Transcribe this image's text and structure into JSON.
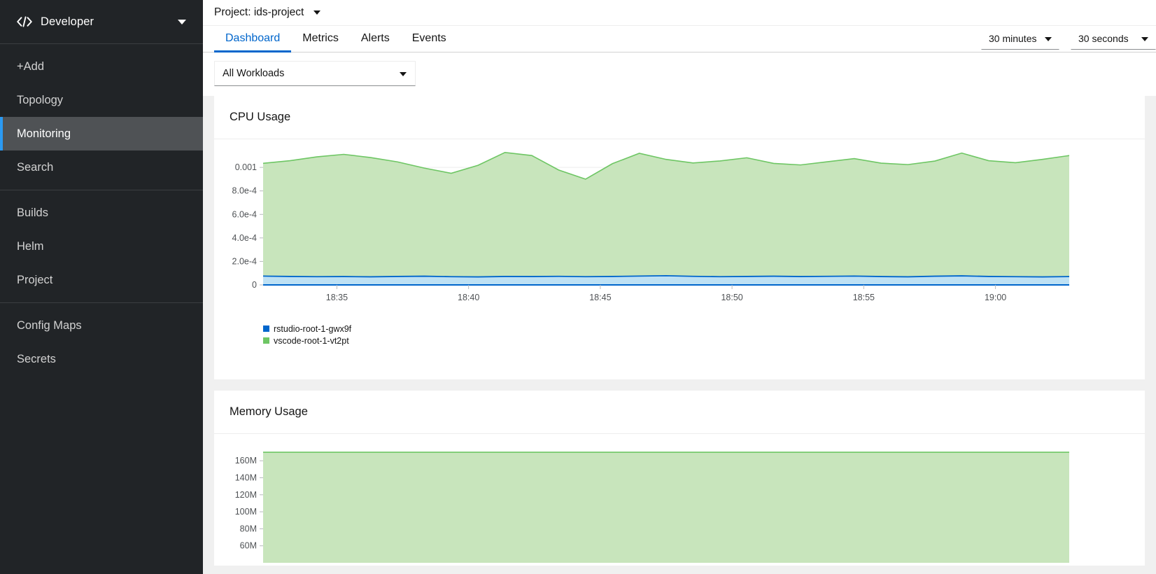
{
  "sidebar": {
    "perspective": {
      "label": "Developer",
      "icon": "code-icon",
      "caret": "chevron-down-icon"
    },
    "groups": [
      {
        "items": [
          {
            "label": "+Add",
            "active": false
          },
          {
            "label": "Topology",
            "active": false
          },
          {
            "label": "Monitoring",
            "active": true
          },
          {
            "label": "Search",
            "active": false
          }
        ]
      },
      {
        "items": [
          {
            "label": "Builds",
            "active": false
          },
          {
            "label": "Helm",
            "active": false
          },
          {
            "label": "Project",
            "active": false
          }
        ]
      },
      {
        "items": [
          {
            "label": "Config Maps",
            "active": false
          },
          {
            "label": "Secrets",
            "active": false
          }
        ]
      }
    ],
    "colors": {
      "bg": "#212427",
      "active_bg": "#4f5255",
      "active_bar": "#2b9af3"
    }
  },
  "header": {
    "project_label": "Project: ids-project",
    "project_caret": "chevron-down-icon"
  },
  "tabs": [
    {
      "label": "Dashboard",
      "active": true
    },
    {
      "label": "Metrics",
      "active": false
    },
    {
      "label": "Alerts",
      "active": false
    },
    {
      "label": "Events",
      "active": false
    }
  ],
  "toolbar": {
    "time_range": {
      "value": "30 minutes",
      "caret": "chevron-down-icon"
    },
    "refresh_interval": {
      "value": "30 seconds",
      "caret": "chevron-down-icon"
    }
  },
  "filters": {
    "workload": {
      "value": "All Workloads",
      "caret": "chevron-down-icon"
    }
  },
  "cards": [
    {
      "title": "CPU Usage"
    },
    {
      "title": "Memory Usage"
    }
  ],
  "colors": {
    "accent": "#0066cc",
    "series_blue_line": "#0066cc",
    "series_blue_fill": "#bee1f4",
    "series_green_line": "#6ec664",
    "series_green_fill": "#c8e5bc",
    "grid": "#ededed",
    "axis_text": "#4f5255",
    "page_bg": "#f0f0f0"
  },
  "chart_data": [
    {
      "type": "area",
      "title": "CPU Usage",
      "xlabel": "",
      "ylabel": "",
      "stacked": true,
      "grid": true,
      "legend_position": "bottom-left",
      "ytick_labels": [
        "0.001",
        "8.0e-4",
        "6.0e-4",
        "4.0e-4",
        "2.0e-4",
        "0"
      ],
      "ytick_values": [
        0.001,
        0.0008,
        0.0006,
        0.0004,
        0.0002,
        0
      ],
      "ylim": [
        0,
        0.00112
      ],
      "xtick_labels": [
        "18:35",
        "18:40",
        "18:45",
        "18:50",
        "18:55",
        "19:00"
      ],
      "x": [
        0,
        1,
        2,
        3,
        4,
        5,
        6,
        7,
        8,
        9,
        10,
        11,
        12,
        13,
        14,
        15,
        16,
        17,
        18,
        19,
        20,
        21,
        22,
        23,
        24,
        25,
        26,
        27,
        28,
        29,
        30
      ],
      "series": [
        {
          "name": "rstudio-root-1-gwx9f",
          "color": "#0066cc",
          "fill": "#bee1f4",
          "values": [
            7.5e-05,
            7.2e-05,
            7e-05,
            7.1e-05,
            6.9e-05,
            7.2e-05,
            7.4e-05,
            7e-05,
            6.8e-05,
            7.2e-05,
            7.1e-05,
            7.3e-05,
            7e-05,
            7.2e-05,
            7.5e-05,
            7.8e-05,
            7.3e-05,
            7e-05,
            7.2e-05,
            7.4e-05,
            7.1e-05,
            7.3e-05,
            7.5e-05,
            7.1e-05,
            6.9e-05,
            7.4e-05,
            7.7e-05,
            7.2e-05,
            7e-05,
            6.8e-05,
            7.1e-05
          ]
        },
        {
          "name": "vscode-root-1-vt2pt",
          "color": "#6ec664",
          "fill": "#c8e5bc",
          "values": [
            0.00096,
            0.000985,
            0.00102,
            0.00104,
            0.001015,
            0.000975,
            0.00092,
            0.00088,
            0.00095,
            0.001055,
            0.00103,
            0.000905,
            0.00083,
            0.00096,
            0.001045,
            0.00099,
            0.000965,
            0.000985,
            0.00101,
            0.00096,
            0.00095,
            0.000975,
            0.001,
            0.000965,
            0.000955,
            0.00098,
            0.001045,
            0.000985,
            0.00097,
            0.001,
            0.00103
          ]
        }
      ],
      "legend": [
        {
          "label": "rstudio-root-1-gwx9f",
          "color": "#0066cc"
        },
        {
          "label": "vscode-root-1-vt2pt",
          "color": "#6ec664"
        }
      ]
    },
    {
      "type": "area",
      "title": "Memory Usage",
      "xlabel": "",
      "ylabel": "",
      "stacked": true,
      "grid": true,
      "ytick_labels": [
        "160M",
        "140M",
        "120M",
        "100M",
        "80M",
        "60M"
      ],
      "ytick_values": [
        160000000,
        140000000,
        120000000,
        100000000,
        80000000,
        60000000
      ],
      "ylim": [
        40000000,
        175000000
      ],
      "xtick_labels": [],
      "series": [
        {
          "name": "vscode-root-1-vt2pt",
          "color": "#6ec664",
          "fill": "#c8e5bc",
          "values": [
            170000000,
            170000000,
            170000000,
            170000000,
            170000000,
            170000000,
            170000000,
            170000000,
            170000000,
            170000000,
            170000000
          ]
        }
      ],
      "legend": []
    }
  ]
}
